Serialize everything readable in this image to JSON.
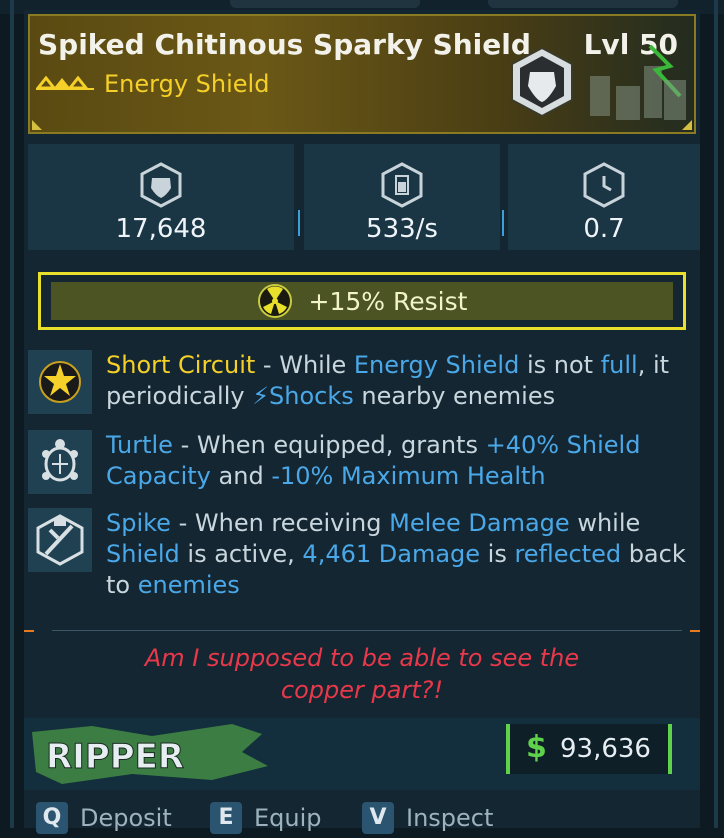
{
  "item": {
    "name": "Spiked Chitinous Sparky Shield",
    "level": "Lvl 50",
    "rarity_type": "Energy Shield",
    "rarity_color": "#f4d028"
  },
  "stats": [
    {
      "icon": "shield-capacity-icon",
      "value": "17,648"
    },
    {
      "icon": "recharge-rate-icon",
      "value": "533/s"
    },
    {
      "icon": "recharge-delay-icon",
      "value": "0.7"
    }
  ],
  "resist": {
    "icon": "radiation-icon",
    "text": "+15% Resist"
  },
  "perks": [
    {
      "icon": "short-circuit-icon",
      "segments": [
        {
          "t": "Short Circuit",
          "c": "yellow"
        },
        {
          "t": " - While ",
          "c": ""
        },
        {
          "t": "Energy Shield",
          "c": "blue"
        },
        {
          "t": " is not ",
          "c": ""
        },
        {
          "t": "full",
          "c": "blue"
        },
        {
          "t": ", it periodically ",
          "c": ""
        },
        {
          "t": "⚡Shocks",
          "c": "blue"
        },
        {
          "t": " nearby enemies",
          "c": ""
        }
      ]
    },
    {
      "icon": "turtle-icon",
      "segments": [
        {
          "t": "Turtle",
          "c": "blue"
        },
        {
          "t": " - When equipped, grants ",
          "c": ""
        },
        {
          "t": "+40% Shield Capacity",
          "c": "blue"
        },
        {
          "t": " and ",
          "c": ""
        },
        {
          "t": "-10% Maximum Health",
          "c": "blue"
        }
      ]
    },
    {
      "icon": "spike-icon",
      "segments": [
        {
          "t": "Spike",
          "c": "blue"
        },
        {
          "t": " - When receiving ",
          "c": ""
        },
        {
          "t": "Melee Damage",
          "c": "blue"
        },
        {
          "t": " while ",
          "c": ""
        },
        {
          "t": "Shield",
          "c": "blue"
        },
        {
          "t": " is active, ",
          "c": ""
        },
        {
          "t": "4,461 Damage",
          "c": "blue"
        },
        {
          "t": " is ",
          "c": ""
        },
        {
          "t": "reflected",
          "c": "blue"
        },
        {
          "t": " back to ",
          "c": ""
        },
        {
          "t": "enemies",
          "c": "blue"
        }
      ]
    }
  ],
  "flavor_text": "Am I supposed to be able to see the copper part?!",
  "manufacturer": "RIPPER",
  "price": {
    "symbol": "$",
    "value": "93,636"
  },
  "actions": [
    {
      "key": "Q",
      "label": "Deposit"
    },
    {
      "key": "E",
      "label": "Equip"
    },
    {
      "key": "V",
      "label": "Inspect"
    }
  ],
  "colors": {
    "accent_yellow": "#f4d028",
    "accent_blue": "#4aa8e8",
    "flavor_red": "#e8384a",
    "money_green": "#5fd14a"
  }
}
